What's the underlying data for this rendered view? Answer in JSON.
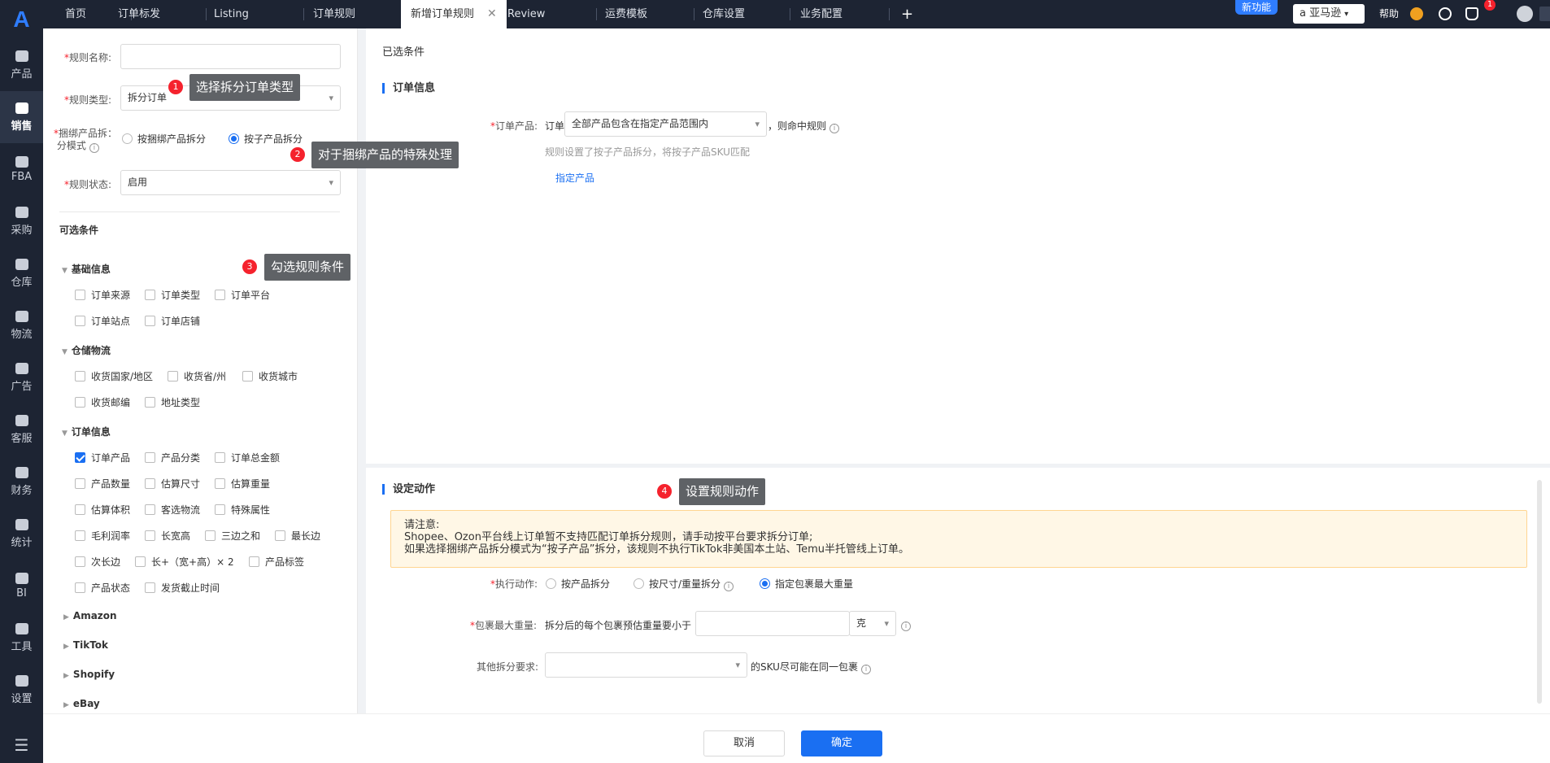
{
  "nav": {
    "items": [
      {
        "label": "产品",
        "icon": "box-icon"
      },
      {
        "label": "销售",
        "icon": "sell-icon",
        "active": true
      },
      {
        "label": "FBA",
        "icon": "fba-icon"
      },
      {
        "label": "采购",
        "icon": "cart-icon"
      },
      {
        "label": "仓库",
        "icon": "warehouse-icon"
      },
      {
        "label": "物流",
        "icon": "truck-icon"
      },
      {
        "label": "广告",
        "icon": "ad-icon"
      },
      {
        "label": "客服",
        "icon": "mail-icon"
      },
      {
        "label": "财务",
        "icon": "yen-icon"
      },
      {
        "label": "统计",
        "icon": "pie-icon"
      },
      {
        "label": "BI",
        "icon": "bi-icon"
      },
      {
        "label": "工具",
        "icon": "wrench-icon"
      },
      {
        "label": "设置",
        "icon": "gear-icon"
      }
    ]
  },
  "tabs": [
    "首页",
    "订单标发",
    "Listing",
    "订单规则",
    "新增订单规则",
    "Review",
    "运费模板",
    "仓库设置",
    "业务配置"
  ],
  "topbar": {
    "new_feature": "新功能",
    "marketplace": "亚马逊",
    "help": "帮助",
    "notif_count": "1"
  },
  "form": {
    "rule_name_label": "规则名称:",
    "rule_name_value": "",
    "rule_type_label": "规则类型:",
    "rule_type_value": "拆分订单",
    "bundle_label_1": "捆绑产品拆",
    "bundle_label_2": "分模式",
    "bundle_opt1": "按捆绑产品拆分",
    "bundle_opt2": "按子产品拆分",
    "status_label": "规则状态:",
    "status_value": "启用"
  },
  "optional": {
    "title": "可选条件",
    "groups": [
      {
        "name": "基础信息",
        "items": [
          "订单来源",
          "订单类型",
          "订单平台",
          "订单站点",
          "订单店铺"
        ]
      },
      {
        "name": "仓储物流",
        "items": [
          "收货国家/地区",
          "收货省/州",
          "收货城市",
          "收货邮编",
          "地址类型"
        ]
      },
      {
        "name": "订单信息",
        "items": [
          "订单产品",
          "产品分类",
          "订单总金额",
          "产品数量",
          "估算尺寸",
          "估算重量",
          "估算体积",
          "客选物流",
          "特殊属性",
          "毛利润率",
          "长宽高",
          "三边之和",
          "最长边",
          "次长边",
          "长+（宽+高）× 2",
          "产品标签",
          "产品状态",
          "发货截止时间"
        ]
      },
      {
        "name": "Amazon"
      },
      {
        "name": "TikTok"
      },
      {
        "name": "Shopify"
      },
      {
        "name": "eBay"
      }
    ]
  },
  "callouts": {
    "c1": {
      "num": "1",
      "text": "选择拆分订单类型"
    },
    "c2": {
      "num": "2",
      "text": "对于捆绑产品的特殊处理"
    },
    "c3": {
      "num": "3",
      "text": "勾选规则条件"
    },
    "c4": {
      "num": "4",
      "text": "设置规则动作"
    }
  },
  "selected": {
    "title": "已选条件",
    "order_info": "订单信息",
    "product_label": "订单产品:",
    "product_prefix": "订单",
    "product_select": "全部产品包含在指定产品范围内",
    "product_suffix": "，则命中规则",
    "hint": "规则设置了按子产品拆分，将按子产品SKU匹配",
    "link": "指定产品"
  },
  "action": {
    "title": "设定动作",
    "notice_1": "请注意:",
    "notice_2": "Shopee、Ozon平台线上订单暂不支持匹配订单拆分规则，请手动按平台要求拆分订单;",
    "notice_3": "如果选择捆绑产品拆分模式为“按子产品”拆分，该规则不执行TikTok非美国本土站、Temu半托管线上订单。",
    "exec_label": "执行动作:",
    "exec_opt1": "按产品拆分",
    "exec_opt2": "按尺寸/重量拆分",
    "exec_opt3": "指定包裹最大重量",
    "max_weight_label": "包裹最大重量:",
    "max_weight_text": "拆分后的每个包裹预估重量要小于",
    "max_weight_value": "",
    "unit": "克",
    "other_label": "其他拆分要求:",
    "other_value": "",
    "other_suffix": "的SKU尽可能在同一包裹"
  },
  "footer": {
    "cancel": "取消",
    "confirm": "确定"
  }
}
